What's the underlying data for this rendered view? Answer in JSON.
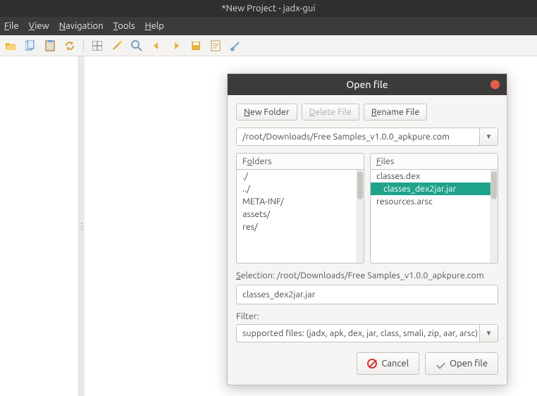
{
  "window": {
    "title": "*New Project - jadx-gui"
  },
  "menubar": {
    "items": [
      {
        "label": "File",
        "accel": "F"
      },
      {
        "label": "View",
        "accel": "V"
      },
      {
        "label": "Navigation",
        "accel": "N"
      },
      {
        "label": "Tools",
        "accel": "T"
      },
      {
        "label": "Help",
        "accel": "H"
      }
    ]
  },
  "toolbar": {
    "icons": [
      "folder-open-icon",
      "copy-icon",
      "paste-icon",
      "sync-icon",
      "grid-icon",
      "wand-icon",
      "zoom-out-icon",
      "back-icon",
      "forward-icon",
      "save-icon",
      "log-icon",
      "settings-icon"
    ]
  },
  "dialog": {
    "title": "Open file",
    "buttons": {
      "new_folder": "New Folder",
      "delete_file": "Delete File",
      "rename_file": "Rename File",
      "cancel": "Cancel",
      "open": "Open file"
    },
    "path": "/root/Downloads/Free Samples_v1.0.0_apkpure.com",
    "folders_label": "Folders",
    "files_label": "Files",
    "folders": [
      "./",
      "../",
      "META-INF/",
      "assets/",
      "res/"
    ],
    "files": [
      {
        "name": "classes.dex",
        "selected": false
      },
      {
        "name": "classes_dex2jar.jar",
        "selected": true
      },
      {
        "name": "resources.arsc",
        "selected": false
      }
    ],
    "selection_label": "Selection: /root/Downloads/Free Samples_v1.0.0_apkpure.com",
    "selection_value": "classes_dex2jar.jar",
    "filter_label": "Filter:",
    "filter_value": "supported files: (jadx, apk, dex, jar, class, smali, zip, aar, arsc)"
  }
}
